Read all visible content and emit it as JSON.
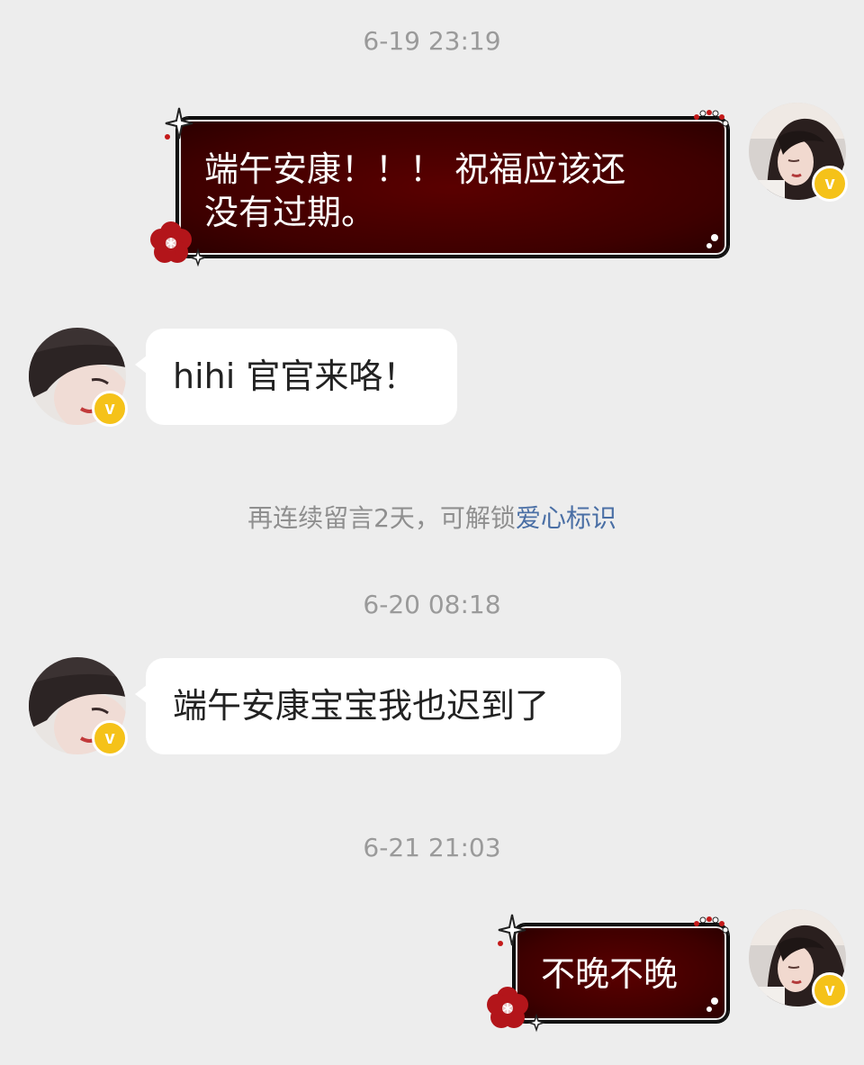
{
  "messages": {
    "ts1": "6-19 23:19",
    "m1": "端午安康！！！ 祝福应该还",
    "m1b": "没有过期。",
    "m2": "hihi 官官来咯！",
    "notice_prefix": "再连续留言2天，可解锁",
    "notice_link": "爱心标识",
    "ts2": "6-20 08:18",
    "m3": "端午安康宝宝我也迟到了",
    "ts3": "6-21 21:03",
    "m4": "不晚不晚"
  },
  "badges": {
    "verified_label": "v"
  },
  "icons": {
    "verified": "verified-badge-icon",
    "flower": "flower-icon",
    "sparkle": "sparkle-icon",
    "beads": "beads-icon"
  },
  "colors": {
    "background": "#ededed",
    "bubble_red": "#4a0000",
    "verified": "#f5c219",
    "link": "#4a6fa5"
  }
}
